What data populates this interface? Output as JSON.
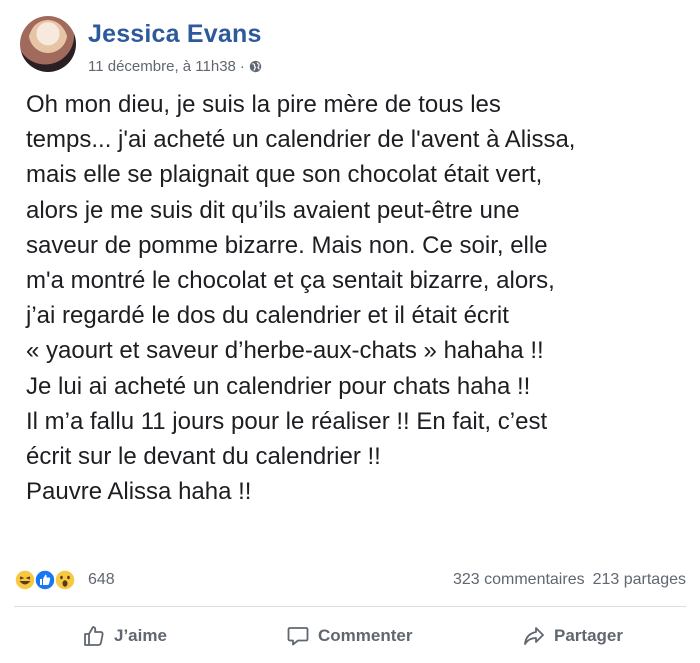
{
  "post": {
    "author": "Jessica Evans",
    "date": "11 décembre, à 11h38",
    "separator": "·",
    "privacy_icon": "globe-icon",
    "lines": [
      "Oh mon dieu, je suis la pire mère de tous les",
      "temps... j'ai acheté un calendrier de l'avent à Alissa,",
      "mais elle se plaignait que son chocolat était vert,",
      "alors je me suis dit qu’ils avaient peut-être une",
      "saveur de pomme bizarre. Mais non. Ce soir, elle",
      "m'a montré le chocolat et ça sentait bizarre, alors,",
      "j’ai regardé le dos du calendrier et il était écrit",
      "« yaourt et saveur d’herbe-aux-chats » hahaha !!",
      "Je lui ai acheté un calendrier pour chats haha !!",
      "Il m’a fallu 11 jours pour le réaliser !! En fait, c’est",
      "écrit sur le devant du calendrier !!",
      "Pauvre Alissa haha !!"
    ]
  },
  "engagement": {
    "reaction_icons": [
      "haha-icon",
      "like-icon",
      "wow-icon"
    ],
    "reaction_count": "648",
    "comments": "323 commentaires",
    "shares": "213 partages"
  },
  "actions": {
    "like": "J’aime",
    "comment": "Commenter",
    "share": "Partager"
  },
  "colors": {
    "author": "#2d5a9a",
    "meta": "#606770",
    "like_blue": "#1877f2",
    "reaction_yellow": "#f7c940"
  }
}
